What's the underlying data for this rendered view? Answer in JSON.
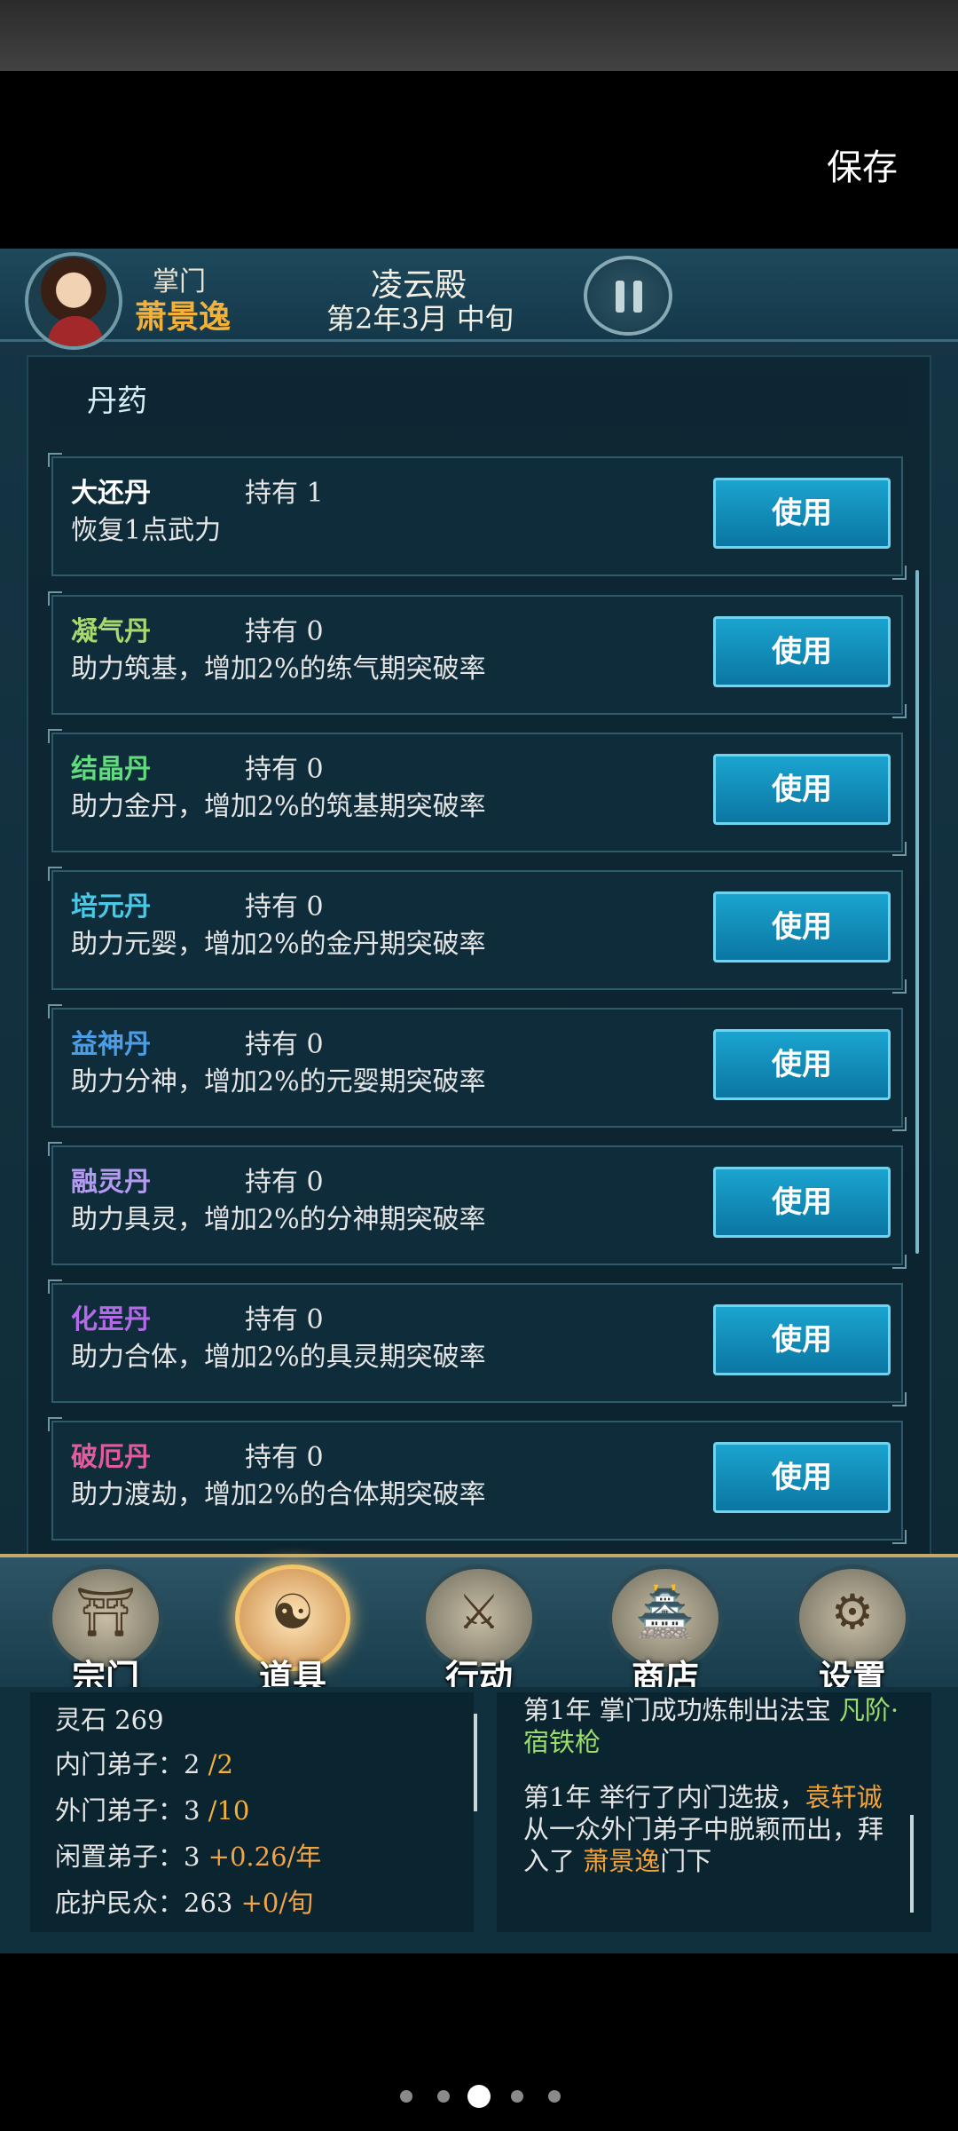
{
  "top_bar": {
    "save_label": "保存"
  },
  "header": {
    "role_label": "掌门",
    "leader_name": "萧景逸",
    "sect_name": "凌云殿",
    "date": "第2年3月 中旬"
  },
  "panel": {
    "section_title": "丹药",
    "items": [
      {
        "name": "大还丹",
        "hold": "持有 1",
        "desc": "恢复1点武力",
        "use_label": "使用",
        "name_color": "#ffffff"
      },
      {
        "name": "凝气丹",
        "hold": "持有 0",
        "desc": "助力筑基，增加2%的练气期突破率",
        "use_label": "使用",
        "name_color": "#a7d96c"
      },
      {
        "name": "结晶丹",
        "hold": "持有 0",
        "desc": "助力金丹，增加2%的筑基期突破率",
        "use_label": "使用",
        "name_color": "#5fdc7c"
      },
      {
        "name": "培元丹",
        "hold": "持有 0",
        "desc": "助力元婴，增加2%的金丹期突破率",
        "use_label": "使用",
        "name_color": "#49c9e6"
      },
      {
        "name": "益神丹",
        "hold": "持有 0",
        "desc": "助力分神，增加2%的元婴期突破率",
        "use_label": "使用",
        "name_color": "#4b9ee6"
      },
      {
        "name": "融灵丹",
        "hold": "持有 0",
        "desc": "助力具灵，增加2%的分神期突破率",
        "use_label": "使用",
        "name_color": "#b49af0"
      },
      {
        "name": "化罡丹",
        "hold": "持有 0",
        "desc": "助力合体，增加2%的具灵期突破率",
        "use_label": "使用",
        "name_color": "#b26ae6"
      },
      {
        "name": "破厄丹",
        "hold": "持有 0",
        "desc": "助力渡劫，增加2%的合体期突破率",
        "use_label": "使用",
        "name_color": "#e25b9c"
      }
    ]
  },
  "nav": {
    "items": [
      {
        "label": "宗门",
        "icon": "sect-gate-icon",
        "glyph": "⛩"
      },
      {
        "label": "道具",
        "icon": "item-bag-icon",
        "glyph": "☯"
      },
      {
        "label": "行动",
        "icon": "action-sword-icon",
        "glyph": "⚔"
      },
      {
        "label": "商店",
        "icon": "shop-icon",
        "glyph": "🏯"
      },
      {
        "label": "设置",
        "icon": "gear-icon",
        "glyph": "⚙"
      }
    ],
    "active_index": 1
  },
  "stats": {
    "spirit_stone": "灵石 269",
    "inner_label": "内门弟子：2",
    "inner_cap": "/2",
    "outer_label": "外门弟子：3",
    "outer_cap": "/10",
    "idle_label": "闲置弟子：3",
    "idle_rate": "+0.26/年",
    "people_label": "庇护民众：263",
    "people_rate": "+0/旬"
  },
  "log": {
    "entry1_text": "第1年 掌门成功炼制出法宝",
    "entry1_item": "凡阶·宿铁枪",
    "entry2_prefix": "第1年 举行了内门选拔，",
    "entry2_disciple": "袁轩诚",
    "entry2_middle": "从一众外门弟子中脱颖而出，拜入了",
    "entry2_master": "萧景逸",
    "entry2_suffix": "门下"
  },
  "pager": {
    "count": 5,
    "active_index": 2
  }
}
